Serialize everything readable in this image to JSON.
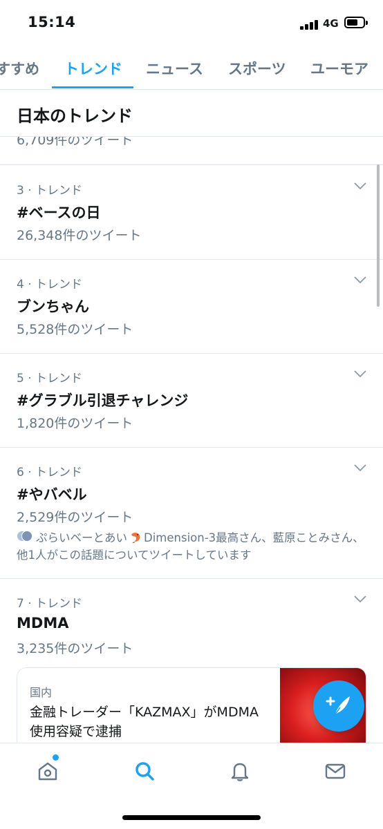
{
  "status_bar": {
    "time": "15:14",
    "network": "4G",
    "battery_fraction": 0.7
  },
  "tabs": [
    {
      "label": "すすめ",
      "active": false
    },
    {
      "label": "トレンド",
      "active": true
    },
    {
      "label": "ニュース",
      "active": false
    },
    {
      "label": "スポーツ",
      "active": false
    },
    {
      "label": "ユーモア",
      "active": false
    }
  ],
  "section": {
    "title": "日本のトレンド"
  },
  "partial_item": {
    "count": "6,709件のツイート"
  },
  "trends": [
    {
      "meta": "3 · トレンド",
      "name": "#ベースの日",
      "count": "26,348件のツイート"
    },
    {
      "meta": "4 · トレンド",
      "name": "ブンちゃん",
      "count": "5,528件のツイート"
    },
    {
      "meta": "5 · トレンド",
      "name": "#グラブル引退チャレンジ",
      "count": "1,820件のツイート"
    },
    {
      "meta": "6 · トレンド",
      "name": "#やバベル",
      "count": "2,529件のツイート",
      "context_part1": "ぷらいベーとあい",
      "context_part2": "Dimension-3最高さん、藍原ことみさん、他1人がこの話題についてツイートしています"
    },
    {
      "meta": "7 · トレンド",
      "name": "MDMA",
      "count": "3,235件のツイート"
    }
  ],
  "news_card": {
    "category": "国内",
    "title": "金融トレーダー「KAZMAX」がMDMA使用容疑で逮捕"
  },
  "colors": {
    "accent": "#1da1f2",
    "secondary_text": "#657786",
    "divider": "#e1e8ed"
  },
  "icons": {
    "fab": "compose-tweet-icon",
    "nav": [
      "home-icon",
      "search-icon",
      "notifications-icon",
      "messages-icon"
    ]
  }
}
